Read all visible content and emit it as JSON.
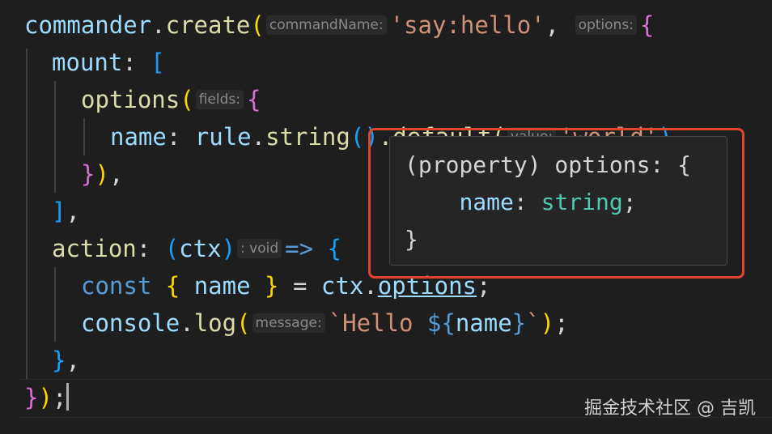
{
  "code": {
    "line1": {
      "obj": "commander",
      "dot": ".",
      "method": "create",
      "open": "(",
      "hint_name": "commandName:",
      "arg": "'say:hello'",
      "comma": ",",
      "hint_options": "options:",
      "brace": "{"
    },
    "line2": {
      "key": "mount",
      "colon": ":",
      "bracket": "["
    },
    "line3": {
      "fn": "options",
      "open": "(",
      "hint": "fields:",
      "brace": "{"
    },
    "line4": {
      "key": "name",
      "colon": ":",
      "obj": "rule",
      "dot": ".",
      "method": "string",
      "call": "()",
      "rest": ".default(",
      "hint": "value:",
      "arg": "'world'",
      "close": ")"
    },
    "line5": {
      "brace": "}",
      "paren": ")",
      "comma": ","
    },
    "line6": {
      "bracket": "]",
      "comma": ","
    },
    "line7": {
      "key": "action",
      "colon": ":",
      "open": "(",
      "param": "ctx",
      "close": ")",
      "hint": ": void",
      "arrow": "=>",
      "brace": "{"
    },
    "line8": {
      "kw": "const",
      "open": "{",
      "name": "name",
      "close": "}",
      "eq": "=",
      "obj": "ctx",
      "dot": ".",
      "prop": "options",
      "semi": ";"
    },
    "line9": {
      "obj": "console",
      "dot": ".",
      "method": "log",
      "open": "(",
      "hint": "message:",
      "tpl_start": "`Hello ",
      "interp_open": "${",
      "interp_var": "name",
      "interp_close": "}",
      "tpl_end": "`",
      "close": ")",
      "semi": ";"
    },
    "line10": {
      "brace": "}",
      "comma": ","
    },
    "line11": {
      "brace": "}",
      "paren": ")",
      "semi": ";"
    }
  },
  "tooltip": {
    "line1": "(property) options: {",
    "line2_key": "name",
    "line2_colon": ":",
    "line2_type": "string",
    "line2_semi": ";",
    "line3": "}"
  },
  "watermark": "掘金技术社区 @ 吉凯",
  "colors": {
    "highlight": "#e0442a",
    "background": "#1e1e1e"
  }
}
